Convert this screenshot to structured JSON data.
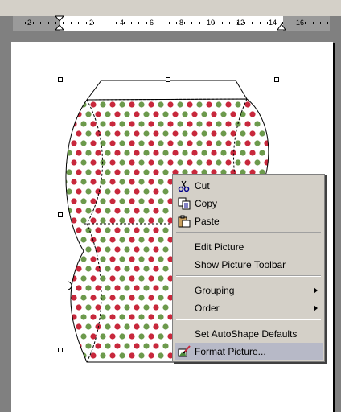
{
  "ruler": {
    "numbers": [
      "2",
      "2",
      "4",
      "6",
      "8",
      "10",
      "12",
      "14",
      "16"
    ]
  },
  "shape": {
    "pattern_colors": {
      "red": "#c8283c",
      "green": "#6c9a4c",
      "background": "#ffffff",
      "outline": "#000000"
    }
  },
  "context_menu": {
    "items": [
      {
        "label": "Cut",
        "icon": "scissors-icon"
      },
      {
        "label": "Copy",
        "icon": "copy-icon"
      },
      {
        "label": "Paste",
        "icon": "paste-icon"
      },
      {
        "label": "Edit Picture"
      },
      {
        "label": "Show Picture Toolbar"
      },
      {
        "label": "Grouping",
        "submenu": true
      },
      {
        "label": "Order",
        "submenu": true
      },
      {
        "label": "Set AutoShape Defaults"
      },
      {
        "label": "Format Picture...",
        "icon": "format-picture-icon",
        "highlighted": true
      }
    ]
  }
}
